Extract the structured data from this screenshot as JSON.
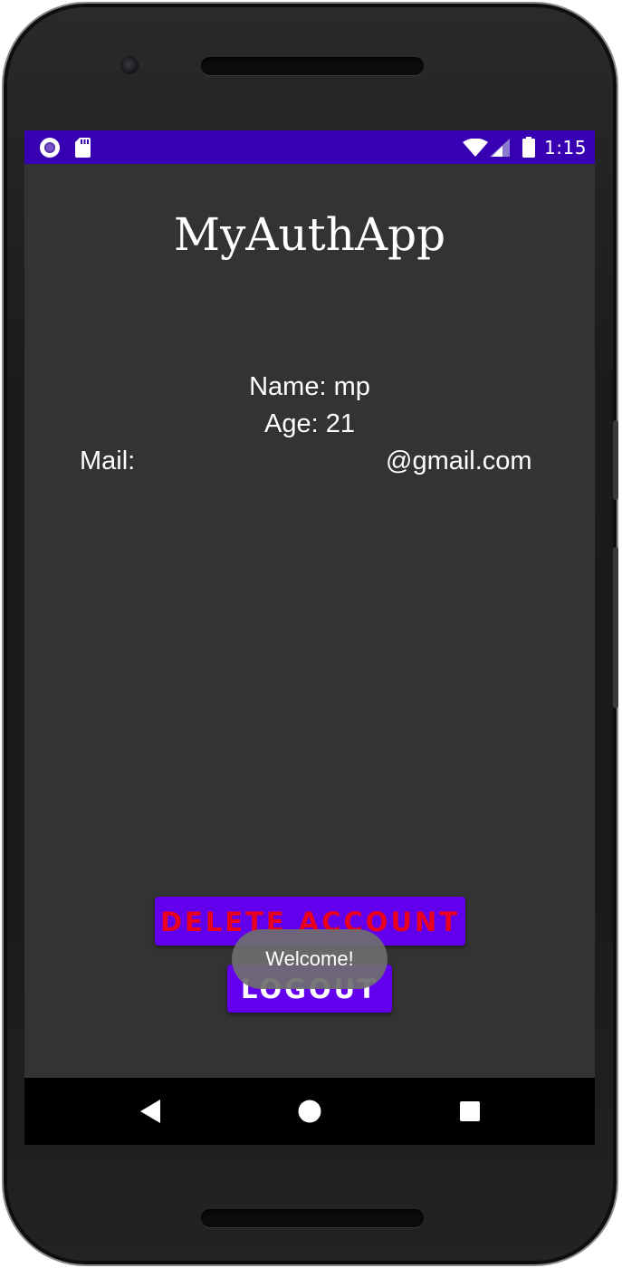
{
  "status_bar": {
    "time": "1:15",
    "icons": [
      "notification-circle-icon",
      "sd-card-icon",
      "wifi-icon",
      "cell-signal-icon",
      "battery-icon"
    ],
    "background_color": "#3700b3"
  },
  "app": {
    "title": "MyAuthApp",
    "background_color": "#333333"
  },
  "profile": {
    "name_line": "Name: mp",
    "age_line": "Age: 21",
    "mail_label": "Mail:",
    "mail_value": "@gmail.com"
  },
  "buttons": {
    "delete_label": "DELETE ACCOUNT",
    "logout_label": "LOGOUT",
    "button_color": "#6200ee",
    "delete_text_color": "#e8001e"
  },
  "toast": {
    "message": "Welcome!"
  },
  "nav_bar": {
    "icons": [
      "back-icon",
      "home-icon",
      "recents-icon"
    ]
  }
}
